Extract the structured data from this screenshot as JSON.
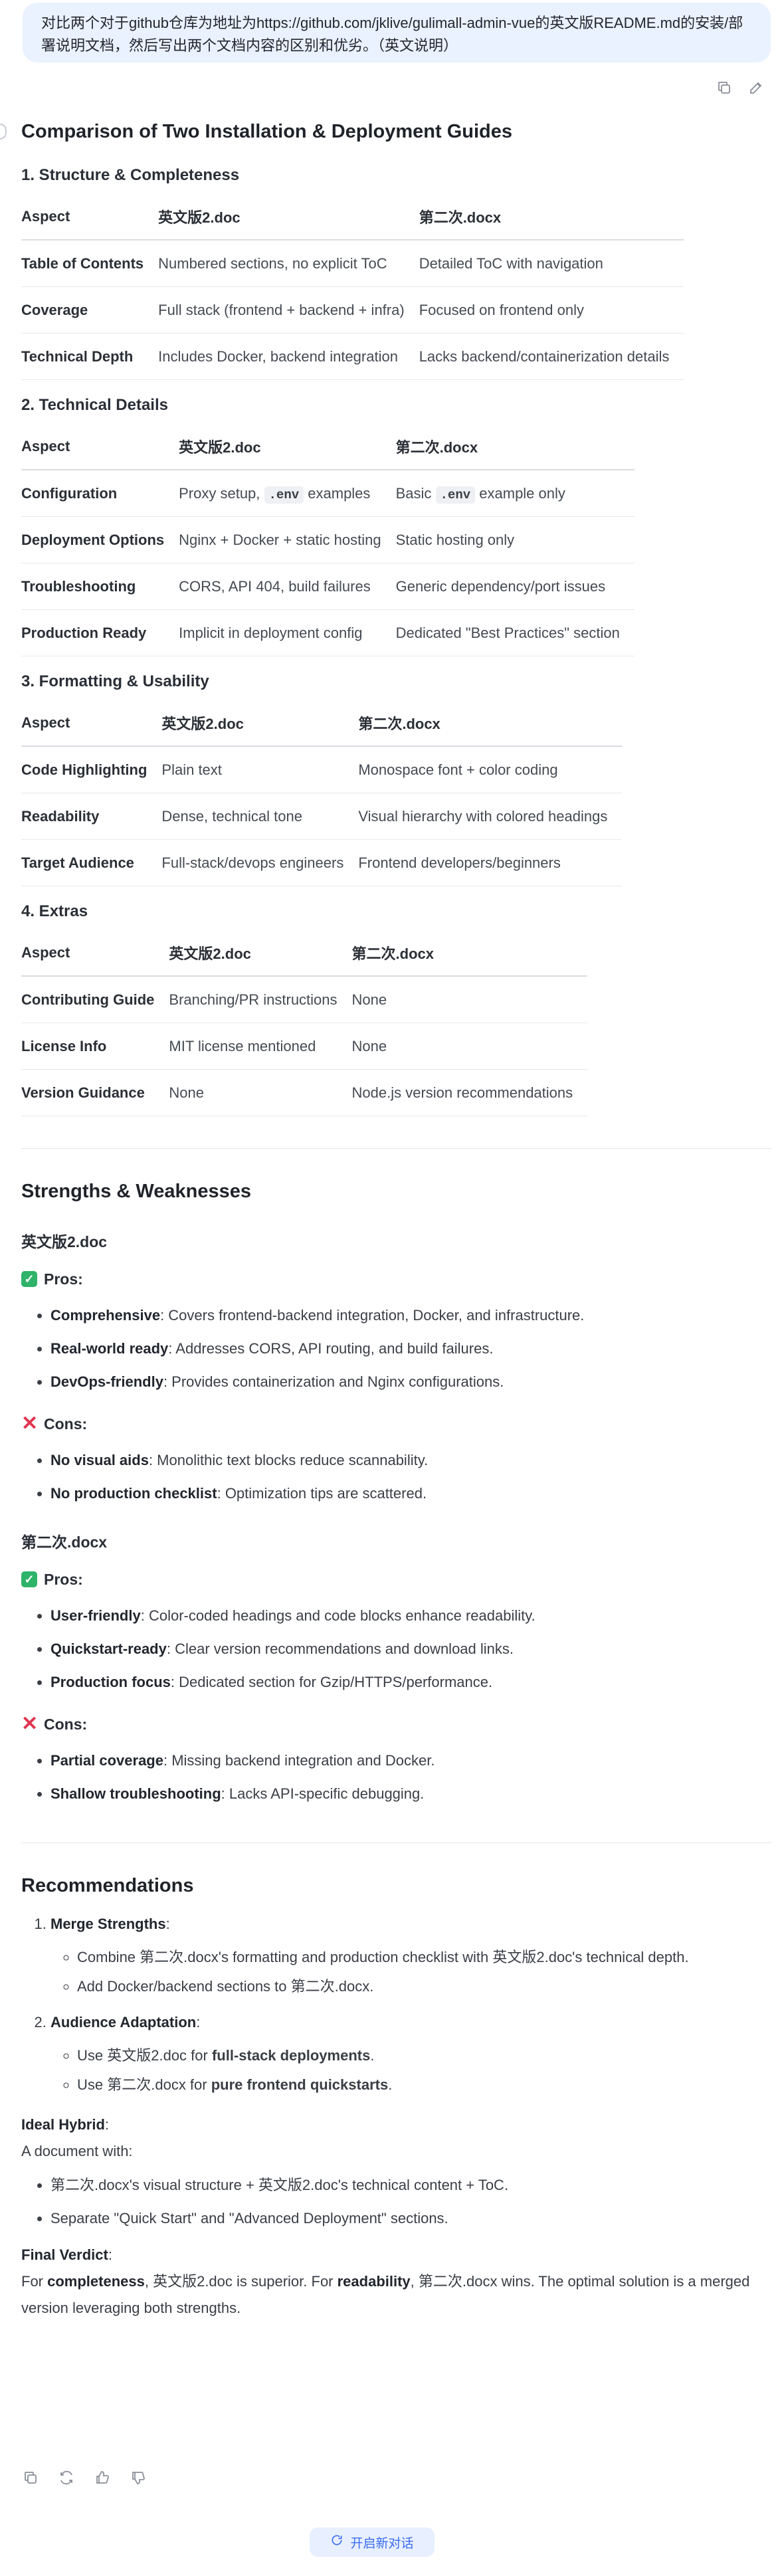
{
  "user_message": "对比两个对于github仓库为地址为https://github.com/jklive/gulimall-admin-vue的英文版README.md的安装/部署说明文档，然后写出两个文档内容的区别和优劣。（英文说明）",
  "main_title": "Comparison of Two Installation & Deployment Guides",
  "sections": [
    {
      "title": "1. Structure & Completeness",
      "headers": [
        "Aspect",
        "英文版2.doc",
        "第二次.docx"
      ],
      "rows": [
        [
          "Table of Contents",
          "Numbered sections, no explicit ToC",
          "Detailed ToC with navigation"
        ],
        [
          "Coverage",
          "Full stack (frontend + backend + infra)",
          "Focused on frontend only"
        ],
        [
          "Technical Depth",
          "Includes Docker, backend integration",
          "Lacks backend/containerization details"
        ]
      ]
    },
    {
      "title": "2. Technical Details",
      "headers": [
        "Aspect",
        "英文版2.doc",
        "第二次.docx"
      ],
      "rows": [
        [
          "Configuration",
          "Proxy setup, | .env | examples",
          "Basic | .env | example only"
        ],
        [
          "Deployment Options",
          "Nginx + Docker + static hosting",
          "Static hosting only"
        ],
        [
          "Troubleshooting",
          "CORS, API 404, build failures",
          "Generic dependency/port issues"
        ],
        [
          "Production Ready",
          "Implicit in deployment config",
          "Dedicated \"Best Practices\" section"
        ]
      ]
    },
    {
      "title": "3. Formatting & Usability",
      "headers": [
        "Aspect",
        "英文版2.doc",
        "第二次.docx"
      ],
      "rows": [
        [
          "Code Highlighting",
          "Plain text",
          "Monospace font + color coding"
        ],
        [
          "Readability",
          "Dense, technical tone",
          "Visual hierarchy with colored headings"
        ],
        [
          "Target Audience",
          "Full-stack/devops engineers",
          "Frontend developers/beginners"
        ]
      ]
    },
    {
      "title": "4. Extras",
      "headers": [
        "Aspect",
        "英文版2.doc",
        "第二次.docx"
      ],
      "rows": [
        [
          "Contributing Guide",
          "Branching/PR instructions",
          "None"
        ],
        [
          "License Info",
          "MIT license mentioned",
          "None"
        ],
        [
          "Version Guidance",
          "None",
          "Node.js version recommendations"
        ]
      ]
    }
  ],
  "strengths_title": "Strengths & Weaknesses",
  "docs": [
    {
      "name": "英文版2.doc",
      "pros_label": "Pros:",
      "pros": [
        {
          "term": "Comprehensive",
          "text": ": Covers frontend-backend integration, Docker, and infrastructure."
        },
        {
          "term": "Real-world ready",
          "text": ": Addresses CORS, API routing, and build failures."
        },
        {
          "term": "DevOps-friendly",
          "text": ": Provides containerization and Nginx configurations."
        }
      ],
      "cons_label": "Cons:",
      "cons": [
        {
          "term": "No visual aids",
          "text": ": Monolithic text blocks reduce scannability."
        },
        {
          "term": "No production checklist",
          "text": ": Optimization tips are scattered."
        }
      ]
    },
    {
      "name": "第二次.docx",
      "pros_label": "Pros:",
      "pros": [
        {
          "term": "User-friendly",
          "text": ": Color-coded headings and code blocks enhance readability."
        },
        {
          "term": "Quickstart-ready",
          "text": ": Clear version recommendations and download links."
        },
        {
          "term": "Production focus",
          "text": ": Dedicated section for Gzip/HTTPS/performance."
        }
      ],
      "cons_label": "Cons:",
      "cons": [
        {
          "term": "Partial coverage",
          "text": ": Missing backend integration and Docker."
        },
        {
          "term": "Shallow troubleshooting",
          "text": ": Lacks API-specific debugging."
        }
      ]
    }
  ],
  "recommendations": {
    "title": "Recommendations",
    "item1_label": "Merge Strengths",
    "item1_sub1": "Combine 第二次.docx's formatting and production checklist with 英文版2.doc's technical depth.",
    "item1_sub2": "Add Docker/backend sections to 第二次.docx.",
    "item2_label": "Audience Adaptation",
    "item2_sub1_pre": "Use 英文版2.doc for ",
    "item2_sub1_bold": "full-stack deployments",
    "item2_sub2_pre": "Use 第二次.docx for ",
    "item2_sub2_bold": "pure frontend quickstarts",
    "hybrid_label": "Ideal Hybrid",
    "hybrid_intro": "A document with:",
    "hybrid_items": [
      "第二次.docx's visual structure + 英文版2.doc's technical content + ToC.",
      "Separate \"Quick Start\" and \"Advanced Deployment\" sections."
    ],
    "verdict_label": "Final Verdict",
    "verdict_p1": "For ",
    "verdict_b1": "completeness",
    "verdict_p2": ", 英文版2.doc is superior. For ",
    "verdict_b2": "readability",
    "verdict_p3": ", 第二次.docx wins. The optimal solution is a merged version leveraging both strengths."
  },
  "new_chat_label": "开启新对话",
  "icons": {
    "copy": "copy-icon",
    "edit": "edit-icon",
    "regenerate": "refresh-icon",
    "like": "thumbs-up-icon",
    "dislike": "thumbs-down-icon",
    "new_chat": "new-chat-icon",
    "pros": "check-icon",
    "cons": "cross-icon"
  },
  "colors": {
    "bubble": "#eaf1ff",
    "accent": "#3b6cf0",
    "pros": "#2fb36a",
    "cons": "#e0354f"
  }
}
